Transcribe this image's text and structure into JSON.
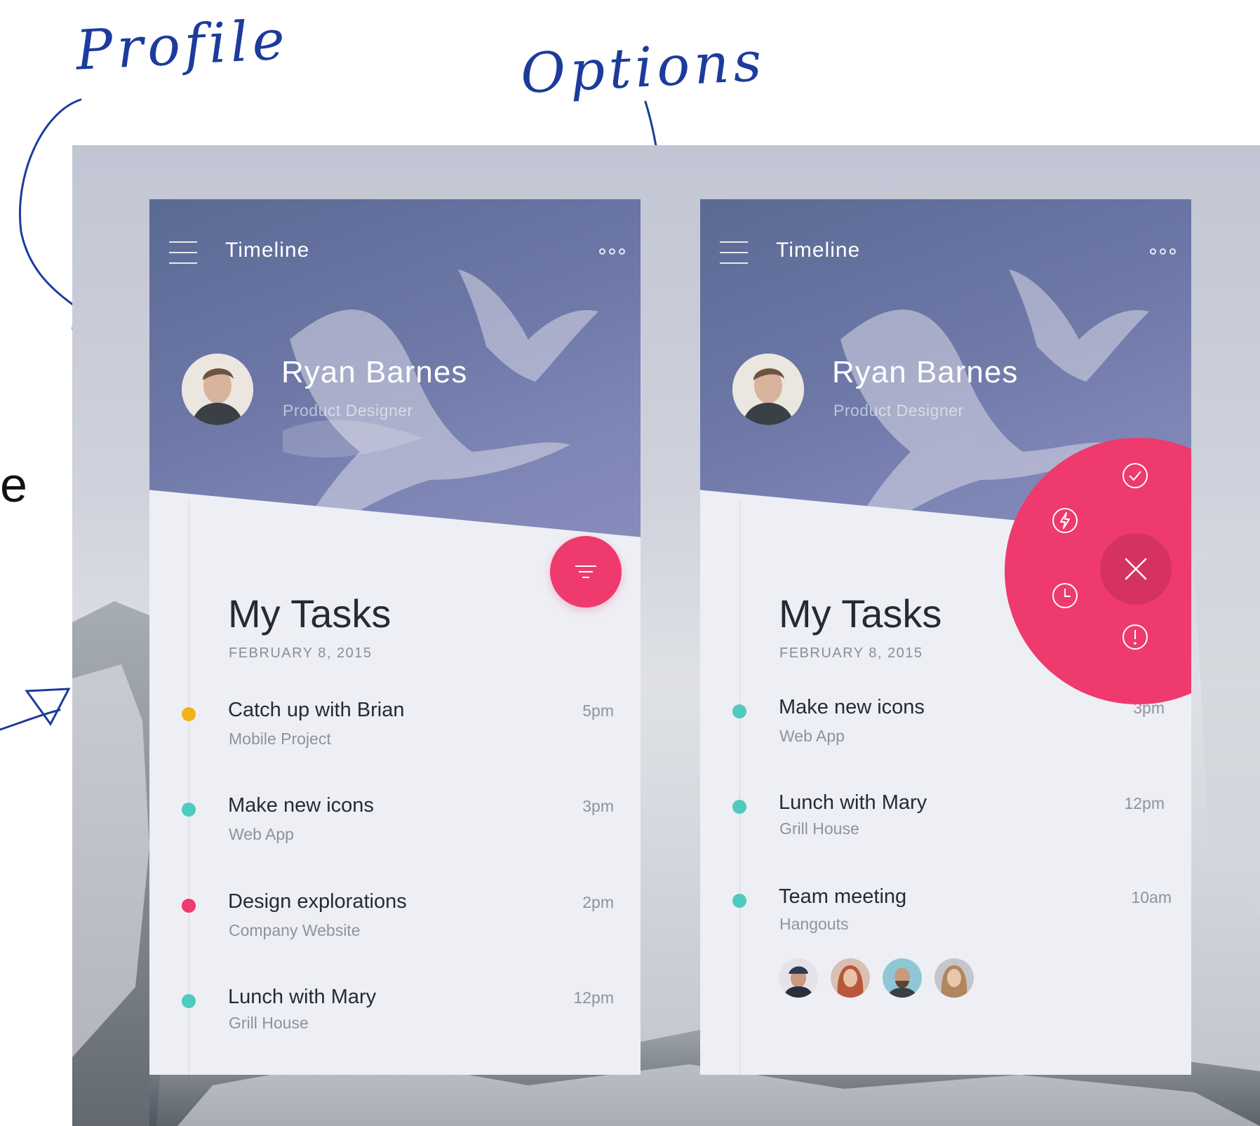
{
  "annotations": {
    "profile": "Profile",
    "options": "Options"
  },
  "left_screen": {
    "header": {
      "title": "Timeline"
    },
    "profile": {
      "name": "Ryan Barnes",
      "role": "Product Designer"
    },
    "section": {
      "title": "My Tasks",
      "date": "FEBRUARY 8, 2015"
    },
    "tasks": [
      {
        "name": "Catch up with Brian",
        "project": "Mobile Project",
        "time": "5pm",
        "color": "#f2b318"
      },
      {
        "name": "Make new icons",
        "project": "Web App",
        "time": "3pm",
        "color": "#4ecbbd"
      },
      {
        "name": "Design explorations",
        "project": "Company Website",
        "time": "2pm",
        "color": "#ee3a6d"
      },
      {
        "name": "Lunch with Mary",
        "project": "Grill House",
        "time": "12pm",
        "color": "#4ecbbd"
      }
    ],
    "fab_icon": "filter-icon"
  },
  "right_screen": {
    "header": {
      "title": "Timeline"
    },
    "profile": {
      "name": "Ryan Barnes",
      "role": "Product Designer"
    },
    "section": {
      "title": "My Tasks",
      "date": "FEBRUARY 8, 2015"
    },
    "tasks": [
      {
        "name": "Make new icons",
        "project": "Web App",
        "time": "3pm",
        "color": "#4ecbbd"
      },
      {
        "name": "Lunch with Mary",
        "project": "Grill House",
        "time": "12pm",
        "color": "#4ecbbd"
      },
      {
        "name": "Team meeting",
        "project": "Hangouts",
        "time": "10am",
        "color": "#4ecbbd"
      }
    ],
    "radial_menu": [
      "check-icon",
      "lightning-icon",
      "clock-icon",
      "alert-icon",
      "close-icon"
    ]
  },
  "colors": {
    "accent": "#ee3a6d",
    "teal": "#4ecbbd",
    "yellow": "#f2b318",
    "ink": "#1c3b9c"
  }
}
